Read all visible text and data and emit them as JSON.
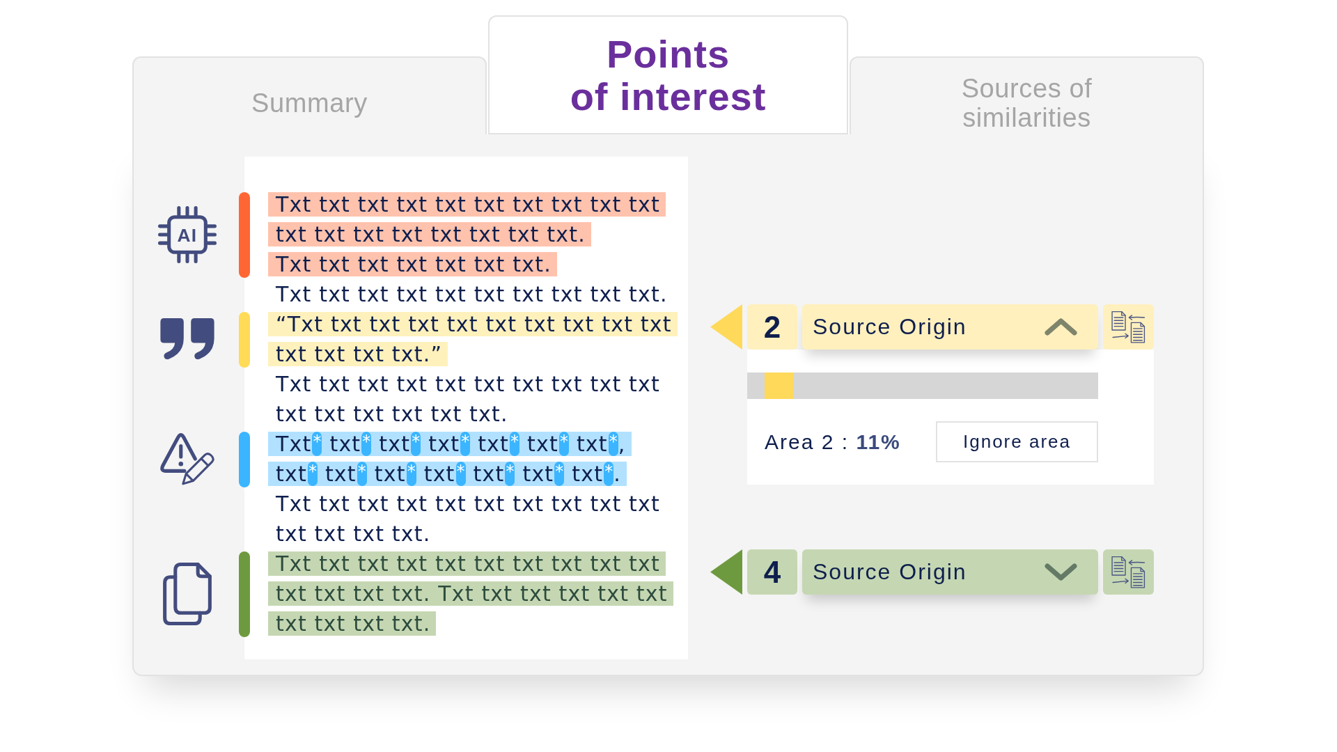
{
  "tabs": [
    {
      "label": "Summary",
      "selected": false
    },
    {
      "label": "Points\nof interest",
      "selected": true
    },
    {
      "label": "Sources of\nsimilarities",
      "selected": false
    }
  ],
  "passages": [
    {
      "kind": "ai",
      "icon_text": "AI",
      "color": "#ff6633",
      "lines": [
        "Txt txt txt txt txt txt txt txt txt txt",
        "txt txt txt txt txt txt txt txt.",
        "Txt txt txt txt txt txt txt."
      ]
    },
    {
      "kind": "plain",
      "lines": [
        "Txt txt txt txt txt txt txt txt txt txt."
      ]
    },
    {
      "kind": "quote",
      "color": "#ffdb58",
      "lines": [
        "“Txt txt txt txt txt txt txt txt txt txt",
        "txt txt txt txt.”"
      ]
    },
    {
      "kind": "plain",
      "lines": [
        "Txt txt txt txt txt txt txt txt txt txt",
        "txt txt txt txt txt txt."
      ]
    },
    {
      "kind": "altered",
      "color": "#3bb5ff",
      "lines": [
        {
          "tokens": [
            {
              "text": "Txt",
              "mark": "*"
            },
            {
              "text": "txt",
              "mark": "*"
            },
            {
              "text": "txt",
              "mark": "*"
            },
            {
              "text": "txt",
              "mark": "*"
            },
            {
              "text": "txt",
              "mark": "*"
            },
            {
              "text": "txt",
              "mark": "*"
            },
            {
              "text": "txt",
              "mark": "*"
            }
          ],
          "end": ","
        },
        {
          "tokens": [
            {
              "text": "txt",
              "mark": "*"
            },
            {
              "text": "txt",
              "mark": "*"
            },
            {
              "text": "txt",
              "mark": "*"
            },
            {
              "text": "txt",
              "mark": "*"
            },
            {
              "text": "txt",
              "mark": "*"
            },
            {
              "text": "txt",
              "mark": "*"
            },
            {
              "text": "txt",
              "mark": "*"
            }
          ],
          "end": "."
        }
      ]
    },
    {
      "kind": "plain",
      "lines": [
        "Txt txt txt txt txt txt txt txt txt txt",
        "txt txt txt txt."
      ]
    },
    {
      "kind": "copied",
      "color": "#6e9a3f",
      "lines": [
        "Txt txt txt txt txt txt txt txt txt txt",
        "txt txt txt txt. Txt txt txt txt txt txt",
        "txt txt txt txt."
      ]
    }
  ],
  "sources": [
    {
      "number": "2",
      "title": "Source Origin",
      "color": "#ffd95a",
      "expanded": true,
      "details": {
        "position_bar": {
          "level": 0.08
        },
        "area": "Area 2 : **11%**",
        "button": "Ignore area"
      }
    },
    {
      "number": "4",
      "title": "Source Origin",
      "color": "#6e9a3f",
      "expanded": false
    }
  ]
}
